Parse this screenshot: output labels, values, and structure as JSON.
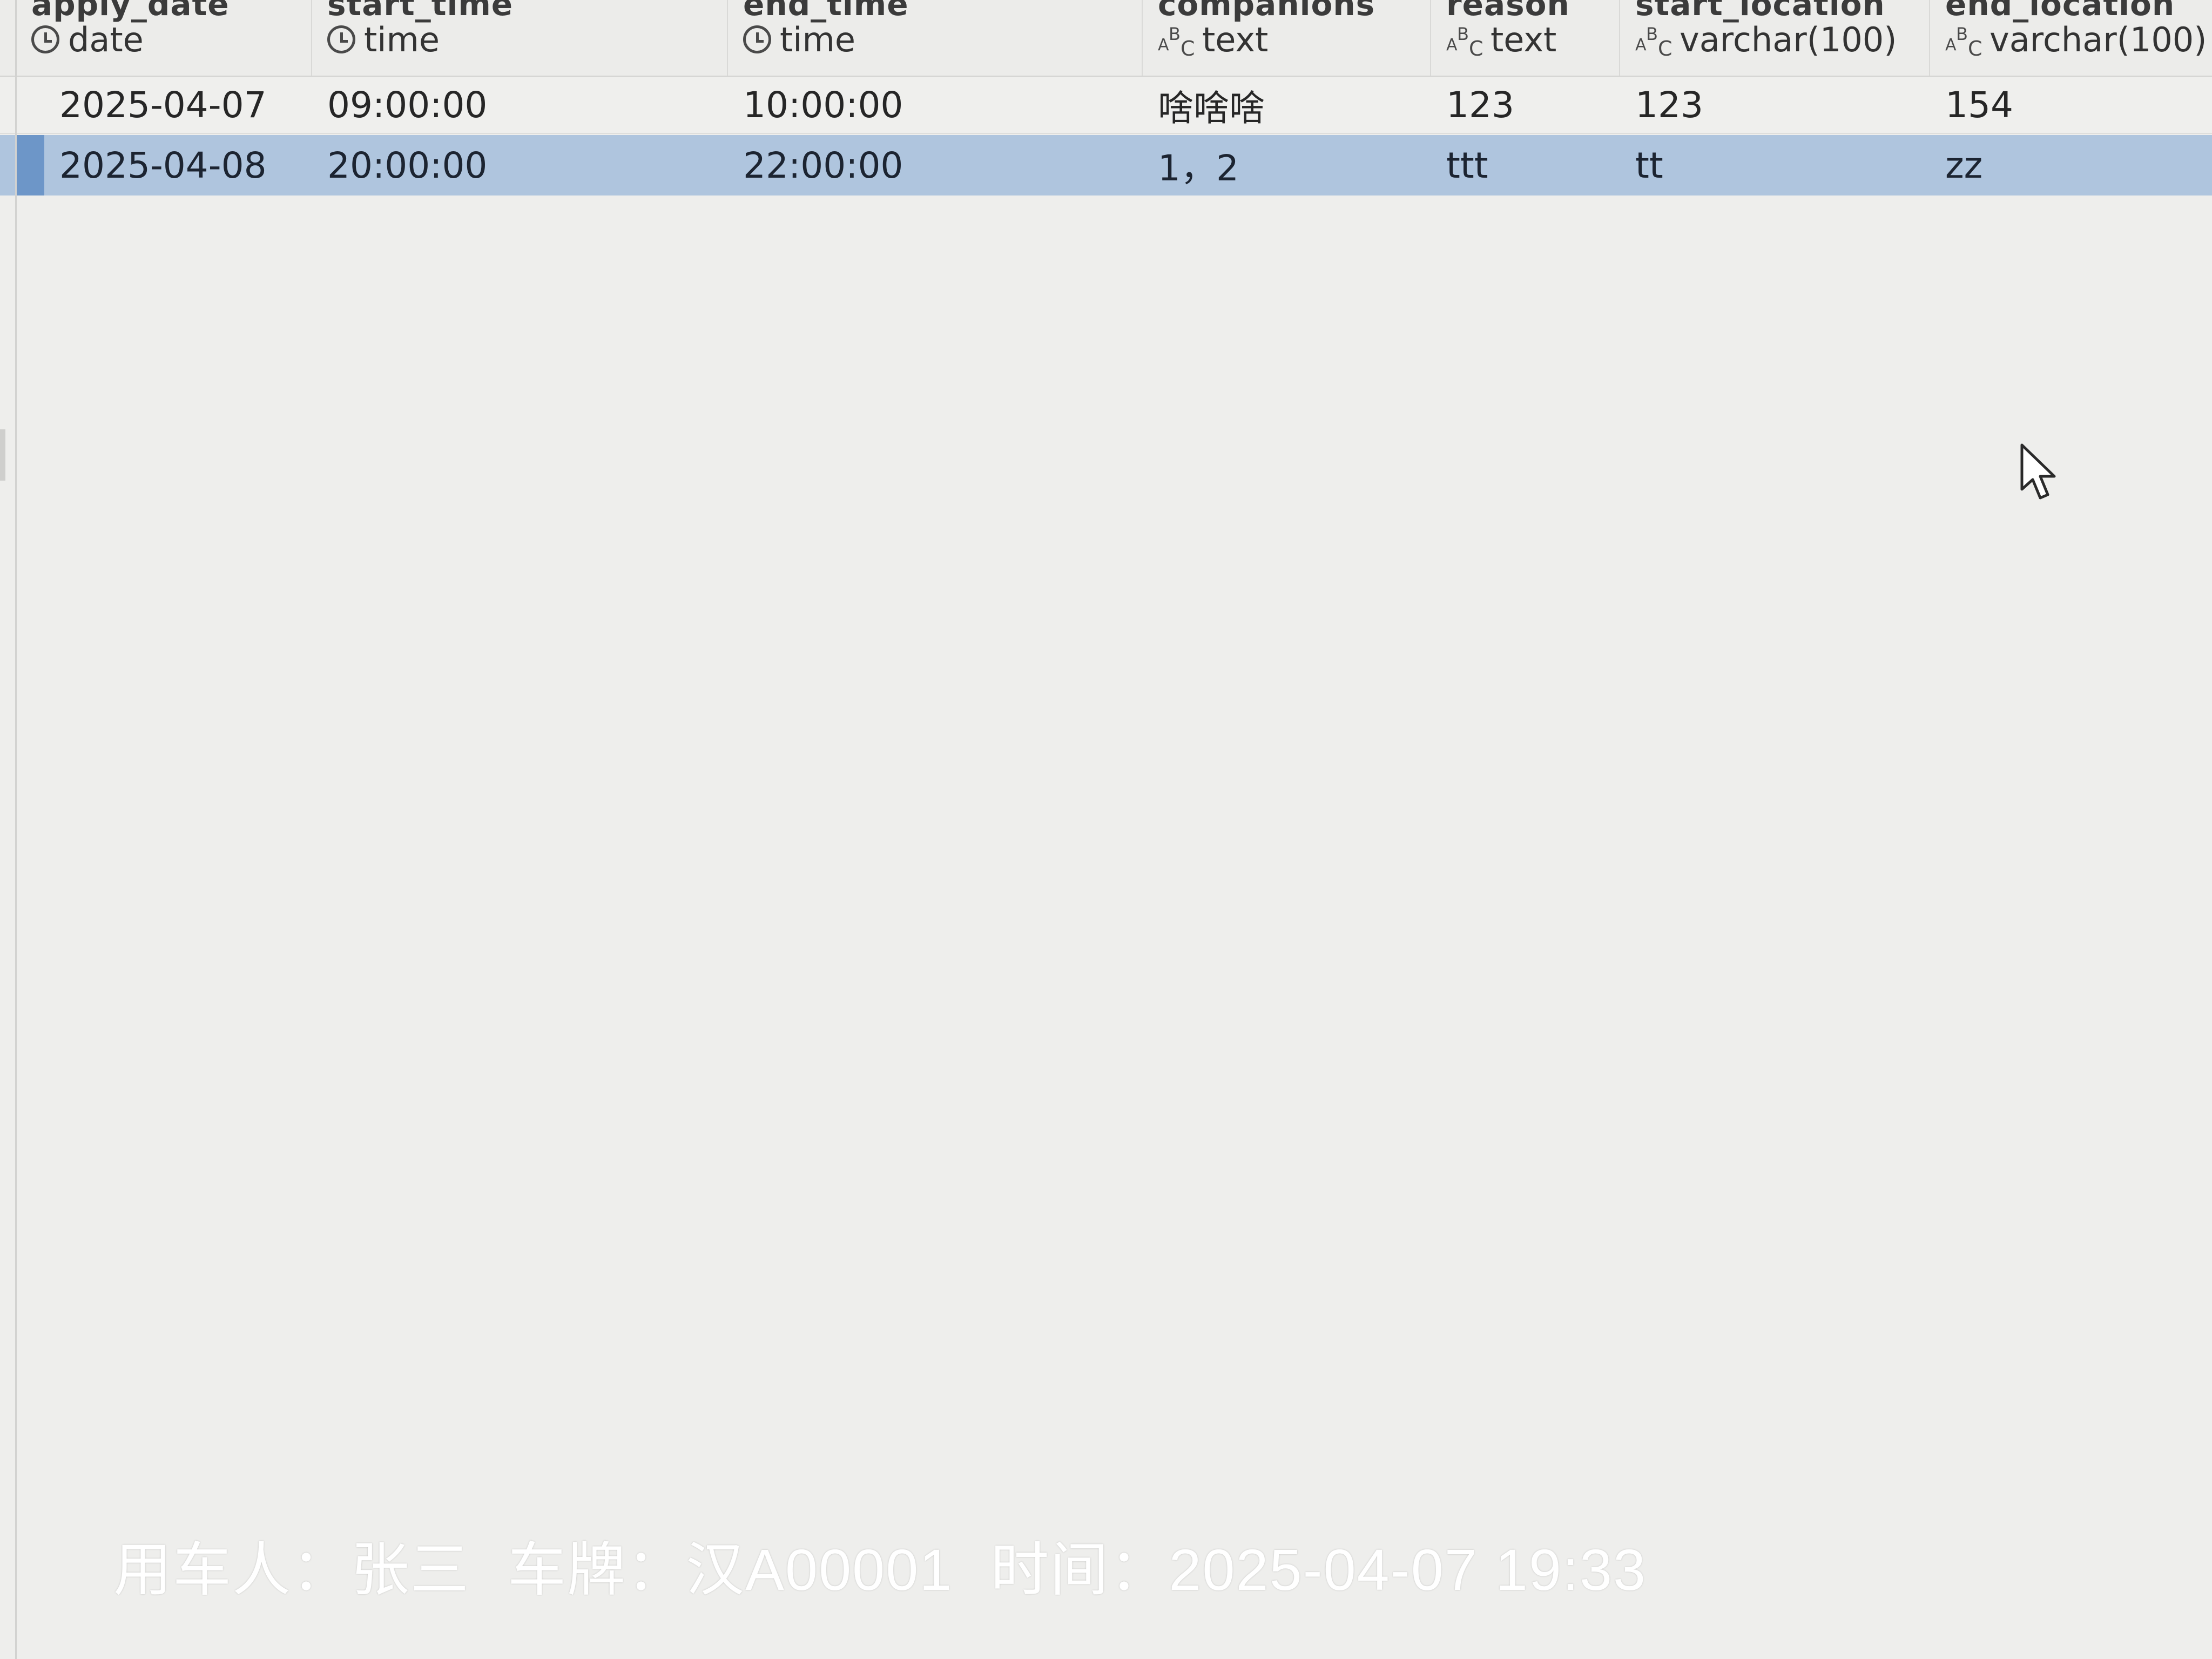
{
  "columns": [
    {
      "name": "apply_date",
      "type": "date",
      "icon": "clock-icon"
    },
    {
      "name": "start_time",
      "type": "time",
      "icon": "clock-icon"
    },
    {
      "name": "end_time",
      "type": "time",
      "icon": "clock-icon"
    },
    {
      "name": "companions",
      "type": "text",
      "icon": "abc-icon"
    },
    {
      "name": "reason",
      "type": "text",
      "icon": "abc-icon"
    },
    {
      "name": "start_location",
      "type": "varchar(100)",
      "icon": "abc-icon"
    },
    {
      "name": "end_location",
      "type": "varchar(100)",
      "icon": "abc-icon"
    }
  ],
  "rows": [
    {
      "cells": [
        "2025-04-07",
        "09:00:00",
        "10:00:00",
        "啥啥啥",
        "123",
        "123",
        "154"
      ],
      "selected": false
    },
    {
      "cells": [
        "2025-04-08",
        "20:00:00",
        "22:00:00",
        "1，2",
        "ttt",
        "tt",
        "zz"
      ],
      "selected": true
    }
  ],
  "watermark": {
    "user": "用车人：张三",
    "plate": "车牌：汉A00001",
    "time": "时间：2025-04-07 19:33"
  },
  "colors": {
    "selected_row": "#afc5de",
    "selected_marker": "#6d96c8",
    "background": "#eeeeec"
  }
}
